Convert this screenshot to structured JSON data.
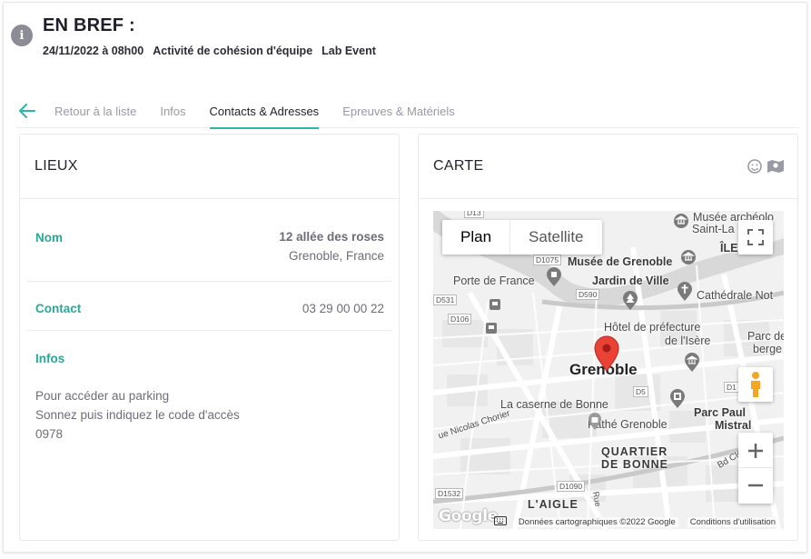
{
  "header": {
    "title": "EN BREF :",
    "date": "24/11/2022 à 08h00",
    "activity": "Activité de cohésion d'équipe",
    "client": "Lab Event"
  },
  "tabs": [
    {
      "label": "Retour à la liste"
    },
    {
      "label": "Infos"
    },
    {
      "label": "Contacts & Adresses"
    },
    {
      "label": "Epreuves & Matériels"
    }
  ],
  "lieux": {
    "title": "LIEUX",
    "nom_label": "Nom",
    "address_line1": "12 allée des roses",
    "address_line2": "Grenoble, France",
    "contact_label": "Contact",
    "contact_value": "03 29 00 00 22",
    "infos_label": "Infos",
    "infos_lines": [
      "Pour accéder au parking",
      "Sonnez puis indiquez le code d'accès",
      "0978"
    ]
  },
  "carte": {
    "title": "CARTE",
    "map_type_plan": "Plan",
    "map_type_satellite": "Satellite",
    "city_label": "Grenoble",
    "labels": {
      "musee_archeo": "Musée archéolo",
      "saint_la": "Saint-La",
      "ile": "ÎLE",
      "musee_grenoble": "Musée de Grenoble",
      "porte_france": "Porte de France",
      "jardin_ville": "Jardin de Ville",
      "cathedrale": "Cathédrale Not",
      "hotel_pref": "Hôtel de préfecture",
      "isere": "de l'Isère",
      "parc_de": "Parc de",
      "berge": "berge",
      "caserne": "La caserne de Bonne",
      "parc_paul": "Parc Paul",
      "mistral": "Mistral",
      "pathe": "Pathé Grenoble",
      "quartier": "QUARTIER",
      "de_bonne": "DE BONNE",
      "aigle": "L'AIGLE",
      "nicolas": "ue Nicolas Chorier",
      "bd_cle": "Bd Clé",
      "rue": "Rue"
    },
    "roads": [
      "D1075",
      "D590",
      "D531",
      "D106",
      "D5",
      "D1090",
      "D1532",
      "D13",
      "D1"
    ],
    "google_logo": "Google",
    "map_data": "Données cartographiques ©2022 Google",
    "terms": "Conditions d'utilisation"
  }
}
